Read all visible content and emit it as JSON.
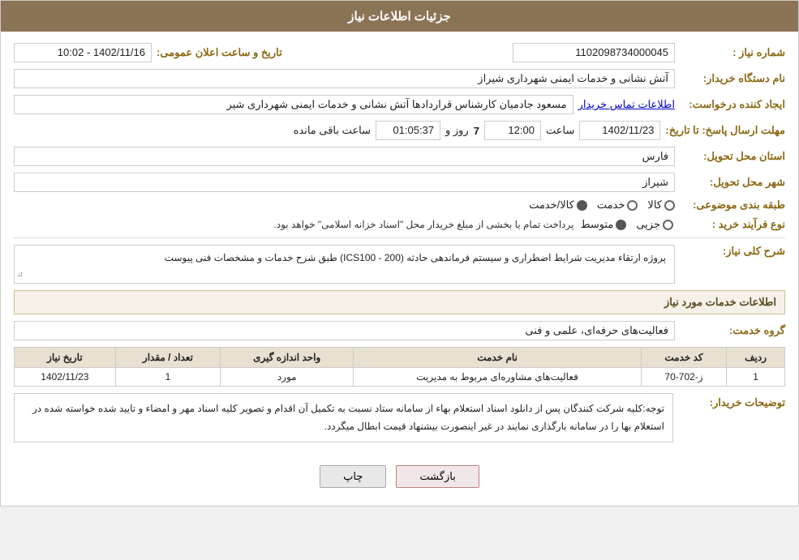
{
  "header": {
    "title": "جزئیات اطلاعات نیاز"
  },
  "fields": {
    "need_number_label": "شماره نیاز :",
    "need_number_value": "1102098734000045",
    "buyer_org_label": "نام دستگاه خریدار:",
    "buyer_org_value": "آتش نشانی و خدمات ایمنی شهرداری شیراز",
    "creator_label": "ایجاد کننده درخواست:",
    "creator_value": "مسعود جادمیان کارشناس قراردادها آتش نشانی و خدمات ایمنی شهرداری شیر",
    "creator_link": "اطلاعات تماس خریدار",
    "deadline_label": "مهلت ارسال پاسخ: تا تاریخ:",
    "deadline_date": "1402/11/23",
    "deadline_time_label": "ساعت",
    "deadline_time": "12:00",
    "deadline_day_label": "روز و",
    "deadline_days": "7",
    "deadline_remaining_label": "ساعت باقی مانده",
    "deadline_remaining": "01:05:37",
    "province_label": "استان محل تحویل:",
    "province_value": "فارس",
    "city_label": "شهر محل تحویل:",
    "city_value": "شیراز",
    "category_label": "طبقه بندی موضوعی:",
    "category_options": [
      {
        "label": "کالا",
        "selected": false
      },
      {
        "label": "خدمت",
        "selected": false
      },
      {
        "label": "کالا/خدمت",
        "selected": true
      }
    ],
    "purchase_type_label": "نوع فرآیند خرید :",
    "purchase_note": "پرداخت تمام یا بخشی از مبلغ خریدار محل \"اسناد خزانه اسلامی\" خواهد بود.",
    "purchase_options": [
      {
        "label": "جزیی",
        "selected": false
      },
      {
        "label": "متوسط",
        "selected": true
      }
    ],
    "announce_date_label": "تاریخ و ساعت اعلان عمومی:",
    "announce_date_value": "1402/11/16 - 10:02"
  },
  "desc_section": {
    "title": "شرح کلی نیاز:",
    "content": "پروژه ارتقاء مدیریت شرایط اضطراری و سیستم فرماندهی حادثه (ICS100 - 200) طبق شرح خدمات و مشخصات فنی پیوست"
  },
  "services_section": {
    "title": "اطلاعات خدمات مورد نیاز",
    "service_group_label": "گروه خدمت:",
    "service_group_value": "فعالیت‌های حرفه‌ای، علمی و فنی",
    "table": {
      "headers": [
        "ردیف",
        "کد خدمت",
        "نام خدمت",
        "واحد اندازه گیری",
        "تعداد / مقدار",
        "تاریخ نیاز"
      ],
      "rows": [
        {
          "row": "1",
          "code": "ز-702-70",
          "name": "فعالیت‌های مشاوره‌ای مربوط به مدیریت",
          "unit": "مورد",
          "qty": "1",
          "date": "1402/11/23"
        }
      ]
    }
  },
  "notice": {
    "label": "توضیحات خریدار:",
    "text": "توجه:کلیه شرکت کنندگان پس از دانلود اسناد استعلام بهاء از سامانه ستاد نسبت به تکمیل آن اقدام و تصویر کلیه اسناد مهر و امضاء و تایید شده خواسته شده در استعلام بها را در سامانه بارگذاری نمایند در غیر اینصورت بیشنهاد قیمت ابطال میگردد."
  },
  "buttons": {
    "print_label": "چاپ",
    "back_label": "بازگشت"
  }
}
